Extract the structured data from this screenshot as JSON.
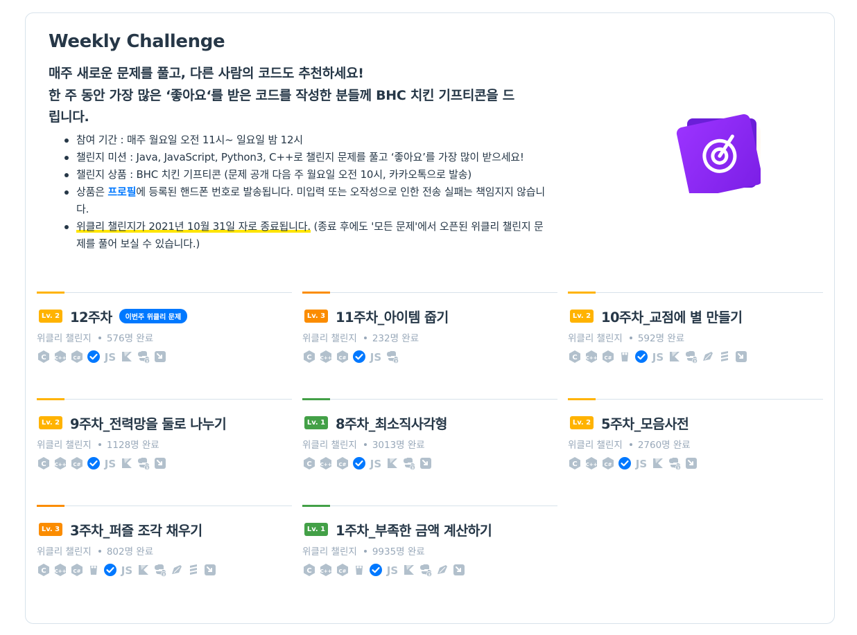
{
  "page": {
    "title": "Weekly Challenge",
    "subtitle_line1": "매주 새로운 문제를 풀고, 다른 사람의 코드도 추천하세요!",
    "subtitle_line2": "한 주 동안 가장 많은 ‘좋아요‘를 받은 코드를 작성한 분들께 BHC 치킨 기프티콘을 드립니다."
  },
  "bullets": [
    "참여 기간 : 매주 월요일 오전 11시~ 일요일 밤 12시",
    "챌린지 미션 : Java, JavaScript, Python3, C++로 챌린지 문제를 풀고 ‘좋아요’를 가장 많이 받으세요!",
    "챌린지 상품 : BHC 치킨 기프티콘 (문제 공개 다음 주 월요일 오전 10시, 카카오톡으로 발송)"
  ],
  "bullet4": {
    "link": "프로필",
    "rest": "에 등록된 핸드폰 번호로 발송됩니다. 미입력 또는 오작성으로 인한 전송 실패는 책임지지 않습니다.",
    "pre": "상품은 "
  },
  "bullet5": {
    "highlight": "위클리 챌린지가 2021년 10월 31일 자로 종료됩니다.",
    "rest": " (종료 후에도 '모든 문제'에서 오픈된 위클리 챌린지 문제를 풀어 보실 수 있습니다.)"
  },
  "colors": {
    "lv1": "#43a047",
    "lv2": "#ffb300",
    "lv3": "#fb8c00",
    "badge": "#0078ff",
    "icon": "#b2c0cc",
    "check": "#0078ff"
  },
  "category": "위클리 챌린지",
  "items": [
    {
      "level": "Lv. 2",
      "title": "12주차",
      "badge": "이번주 위클리 문제",
      "completed": "576명 완료",
      "langs": [
        "c-icon",
        "cpp-icon",
        "csharp-icon",
        "check-icon",
        "js-icon",
        "kotlin-icon",
        "python3-icon",
        "swift-icon"
      ]
    },
    {
      "level": "Lv. 3",
      "title": "11주차_아이템 줍기",
      "badge": "",
      "completed": "232명 완료",
      "langs": [
        "c-icon",
        "cpp-icon",
        "csharp-icon",
        "check-icon",
        "js-icon",
        "python3-icon"
      ]
    },
    {
      "level": "Lv. 2",
      "title": "10주차_교점에 별 만들기",
      "badge": "",
      "completed": "592명 완료",
      "langs": [
        "c-icon",
        "cpp-icon",
        "csharp-icon",
        "go-icon",
        "check-icon",
        "js-icon",
        "kotlin-icon",
        "python3-icon",
        "ruby-icon",
        "scala-icon",
        "swift-icon"
      ]
    },
    {
      "level": "Lv. 2",
      "title": "9주차_전력망을 둘로 나누기",
      "badge": "",
      "completed": "1128명 완료",
      "langs": [
        "c-icon",
        "cpp-icon",
        "csharp-icon",
        "check-icon",
        "js-icon",
        "kotlin-icon",
        "python3-icon",
        "swift-icon"
      ]
    },
    {
      "level": "Lv. 1",
      "title": "8주차_최소직사각형",
      "badge": "",
      "completed": "3013명 완료",
      "langs": [
        "c-icon",
        "cpp-icon",
        "csharp-icon",
        "check-icon",
        "js-icon",
        "kotlin-icon",
        "python3-icon",
        "swift-icon"
      ]
    },
    {
      "level": "Lv. 2",
      "title": "5주차_모음사전",
      "badge": "",
      "completed": "2760명 완료",
      "langs": [
        "c-icon",
        "cpp-icon",
        "csharp-icon",
        "check-icon",
        "js-icon",
        "kotlin-icon",
        "python3-icon",
        "swift-icon"
      ]
    },
    {
      "level": "Lv. 3",
      "title": "3주차_퍼즐 조각 채우기",
      "badge": "",
      "completed": "802명 완료",
      "langs": [
        "c-icon",
        "cpp-icon",
        "csharp-icon",
        "go-icon",
        "check-icon",
        "js-icon",
        "kotlin-icon",
        "python3-icon",
        "ruby-icon",
        "scala-icon",
        "swift-icon"
      ]
    },
    {
      "level": "Lv. 1",
      "title": "1주차_부족한 금액 계산하기",
      "badge": "",
      "completed": "9935명 완료",
      "langs": [
        "c-icon",
        "cpp-icon",
        "csharp-icon",
        "go-icon",
        "check-icon",
        "js-icon",
        "kotlin-icon",
        "python3-icon",
        "ruby-icon",
        "swift-icon"
      ]
    }
  ]
}
